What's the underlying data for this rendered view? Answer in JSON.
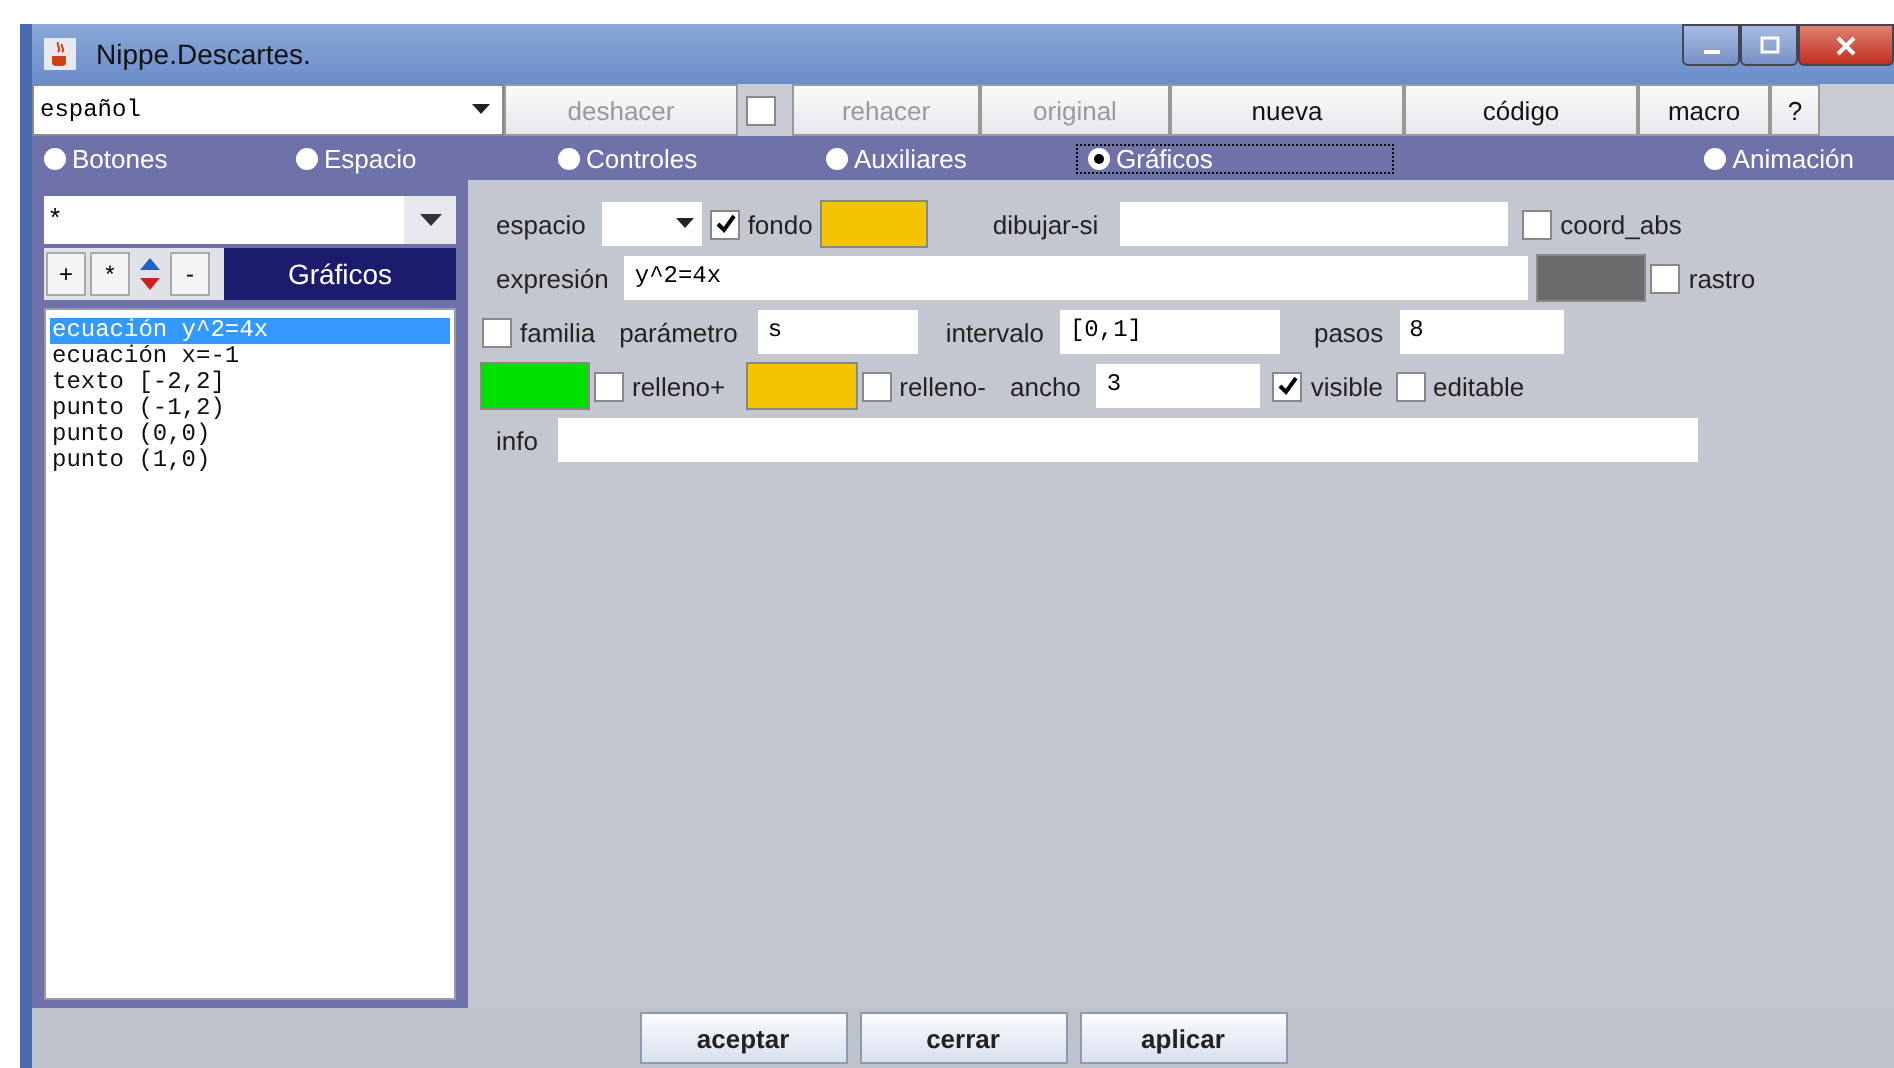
{
  "window": {
    "title": "Nippe.Descartes."
  },
  "toolbar": {
    "language": "español",
    "buttons": [
      {
        "label": "deshacer",
        "disabled": true
      },
      {
        "label": "rehacer",
        "disabled": true
      },
      {
        "label": "original",
        "disabled": true
      },
      {
        "label": "nueva",
        "disabled": false
      },
      {
        "label": "código",
        "disabled": false
      },
      {
        "label": "macro",
        "disabled": false
      },
      {
        "label": "?",
        "disabled": false
      }
    ],
    "undo_check": {
      "checked": false
    }
  },
  "tabs": [
    {
      "label": "Botones",
      "selected": false
    },
    {
      "label": "Espacio",
      "selected": false
    },
    {
      "label": "Controles",
      "selected": false
    },
    {
      "label": "Auxiliares",
      "selected": false
    },
    {
      "label": "Gráficos",
      "selected": true
    },
    {
      "label": "Animación",
      "selected": false
    }
  ],
  "sidebar": {
    "filter": "*",
    "buttons": [
      "+",
      "*",
      "-"
    ],
    "title": "Gráficos",
    "items": [
      {
        "label": "ecuación y^2=4x",
        "selected": true
      },
      {
        "label": "ecuación x=-1",
        "selected": false
      },
      {
        "label": "texto [-2,2]",
        "selected": false
      },
      {
        "label": "punto (-1,2)",
        "selected": false
      },
      {
        "label": "punto (0,0)",
        "selected": false
      },
      {
        "label": "punto (1,0)",
        "selected": false
      }
    ]
  },
  "form": {
    "espacio": {
      "label": "espacio"
    },
    "fondo": {
      "label": "fondo",
      "checked": true,
      "color": "#f5c400"
    },
    "dibujar_si": {
      "label": "dibujar-si"
    },
    "coord_abs": {
      "label": "coord_abs",
      "checked": false
    },
    "expresion": {
      "label": "expresión",
      "value": "y^2=4x"
    },
    "rastro": {
      "label": "rastro",
      "checked": false,
      "color": "#6b6b6b"
    },
    "familia": {
      "label": "familia",
      "checked": false
    },
    "parametro": {
      "label": "parámetro",
      "value": "s"
    },
    "intervalo": {
      "label": "intervalo",
      "value": "[0,1]"
    },
    "pasos": {
      "label": "pasos",
      "value": "8"
    },
    "relleno_plus": {
      "label": "relleno+",
      "checked": false,
      "color": "#00e000"
    },
    "relleno_minus": {
      "label": "relleno-",
      "checked": false,
      "color": "#f5c400"
    },
    "ancho": {
      "label": "ancho",
      "value": "3"
    },
    "visible": {
      "label": "visible",
      "checked": true
    },
    "editable": {
      "label": "editable",
      "checked": false
    },
    "info": {
      "label": "info"
    }
  },
  "footer": {
    "buttons": [
      "aceptar",
      "cerrar",
      "aplicar"
    ]
  }
}
